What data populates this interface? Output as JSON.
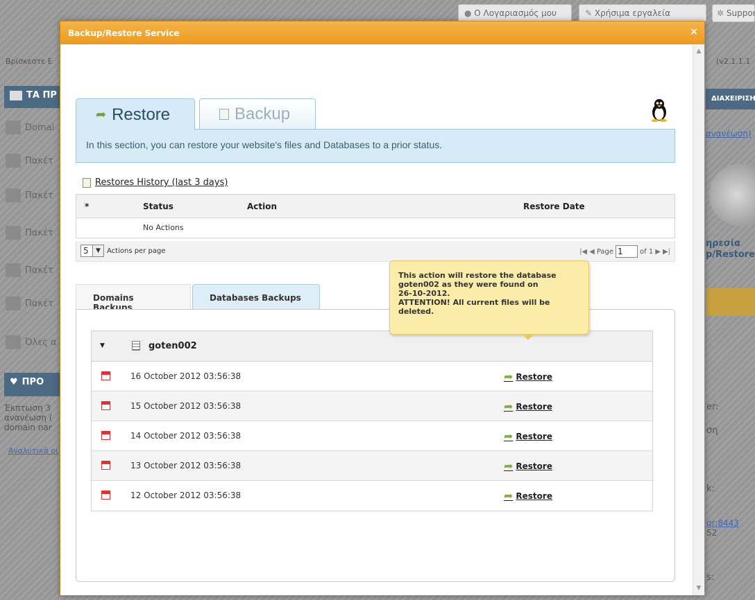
{
  "background": {
    "top_buttons": [
      "Ο Λογαριασμός μου",
      "Χρήσιμα εργαλεία",
      "Support"
    ],
    "breadcrumb": "Βρίσκεστε Ε",
    "version": "(v2.1.1.1",
    "left_bar": "ΤΑ ΠΡ",
    "left_items": [
      "Domai",
      "Πακέτ",
      "Πακέτ",
      "Πακέτ",
      "Πακέτ",
      "Πακέτ",
      "Όλες α"
    ],
    "promo_bar": "ΠΡΟ",
    "promo_text": [
      "Έκπτωση 3",
      "ανανέωση (",
      "domain nar"
    ],
    "promo_link": "Αναλυτικά οι",
    "right_bar": "ΔΙΑΧΕΙΡΙΣΗ",
    "right_link": "ανανέωση)",
    "right_service": [
      "ηρεσία",
      "p/Restore"
    ],
    "right_texts": [
      "er:",
      "ση",
      "k:"
    ],
    "right_link2": "gr:8443",
    "right_num": "52",
    "right_bottom": "s:"
  },
  "dialog": {
    "title": "Backup/Restore Service",
    "close": "×",
    "tabs": {
      "restore": "Restore",
      "backup": "Backup"
    },
    "info": "In this section, you can restore your website's files and Databases to a prior status.",
    "history": {
      "title": "Restores History (last 3 days)",
      "columns": [
        "*",
        "Status",
        "Action",
        "Restore Date"
      ],
      "empty": "No Actions",
      "per_page_value": "5",
      "per_page_label": "Actions per page",
      "page_label": "Page",
      "page_value": "1",
      "page_of": "of 1"
    },
    "subtabs": {
      "domains": "Domains Backups",
      "databases": "Databases Backups"
    },
    "database": {
      "name": "goten002",
      "rows": [
        {
          "date": "16 October 2012 03:56:38",
          "action": "Restore"
        },
        {
          "date": "15 October 2012 03:56:38",
          "action": "Restore"
        },
        {
          "date": "14 October 2012 03:56:38",
          "action": "Restore"
        },
        {
          "date": "13 October 2012 03:56:38",
          "action": "Restore"
        },
        {
          "date": "12 October 2012 03:56:38",
          "action": "Restore"
        }
      ]
    },
    "tooltip": "This action will restore the database\n goten002  as they were  found on\n26-10-2012.\nATTENTION! All current files will be\ndeleted."
  }
}
